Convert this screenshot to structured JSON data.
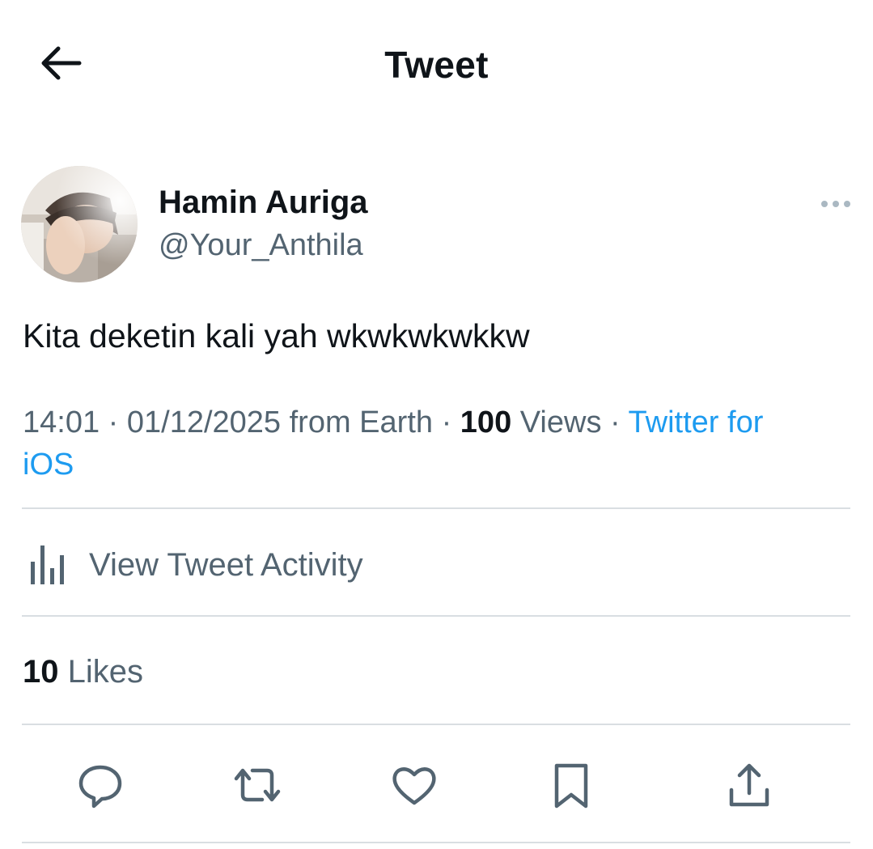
{
  "header": {
    "title": "Tweet",
    "back_icon": "arrow-left-icon"
  },
  "author": {
    "display_name": "Hamin Auriga",
    "handle": "@Your_Anthila",
    "more_icon": "more-horizontal-icon"
  },
  "tweet": {
    "text": "Kita deketin kali yah wkwkwkwkkw"
  },
  "meta": {
    "time": "14:01",
    "separator": " · ",
    "date": "01/12/2025",
    "location": "from Earth",
    "views_count": "100",
    "views_label": " Views",
    "source_line1": "Twitter for",
    "source_line2": "iOS"
  },
  "activity": {
    "label": "View Tweet Activity",
    "icon": "analytics-bars-icon"
  },
  "likes": {
    "count": "10",
    "label": " Likes"
  },
  "actions": [
    {
      "name": "reply",
      "icon": "reply-icon"
    },
    {
      "name": "retweet",
      "icon": "retweet-icon"
    },
    {
      "name": "like",
      "icon": "heart-icon"
    },
    {
      "name": "bookmark",
      "icon": "bookmark-icon"
    },
    {
      "name": "share",
      "icon": "share-icon"
    }
  ],
  "colors": {
    "text_primary": "#0f1419",
    "text_secondary": "#536471",
    "link": "#1d9bf0",
    "divider": "#d9dee2"
  }
}
